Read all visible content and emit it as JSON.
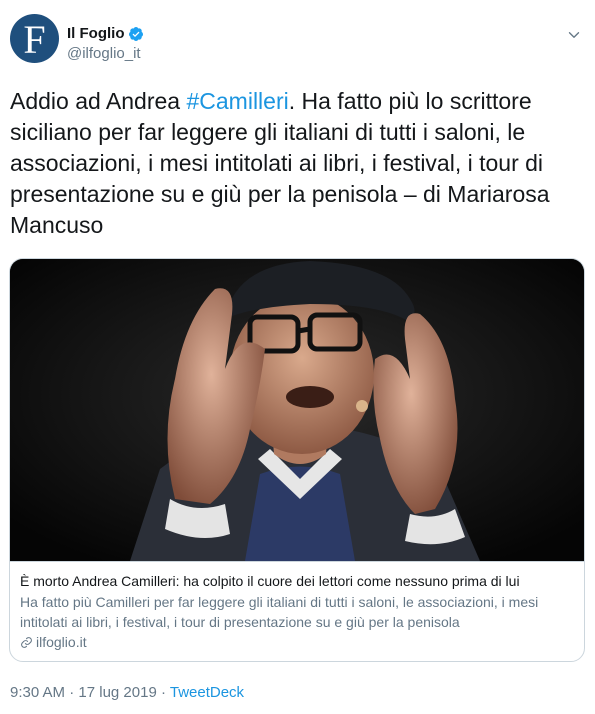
{
  "account": {
    "display_name": "Il Foglio",
    "handle": "@ilfoglio_it",
    "avatar_letter": "F",
    "avatar_color": "#1f4f7d",
    "verified": true
  },
  "tweet": {
    "text_before": "Addio ad Andrea ",
    "hashtag": "#Camilleri",
    "text_after": ". Ha fatto più lo scrittore siciliano per far leggere gli italiani di tutti i saloni, le associazioni, i mesi intitolati ai libri, i festival, i tour di presentazione su e giù per la penisola – di Mariarosa Mancuso"
  },
  "card": {
    "title": "È morto Andrea Camilleri: ha colpito il cuore dei lettori come nessuno prima di lui",
    "description": "Ha fatto più Camilleri per far leggere gli italiani di tutti i saloni, le associazioni, i mesi intitolati ai libri, i festival, i tour di presentazione su e giù per la penisola",
    "domain": "ilfoglio.it"
  },
  "meta": {
    "time": "9:30 AM",
    "separator": " · ",
    "date": "17 lug 2019",
    "source": "TweetDeck"
  },
  "icons": {
    "verified": "verified-badge-icon",
    "chevron": "chevron-down-icon",
    "link": "link-icon"
  },
  "colors": {
    "link_blue": "#1b95e0",
    "muted": "#657786",
    "border": "#ccd6dd"
  }
}
